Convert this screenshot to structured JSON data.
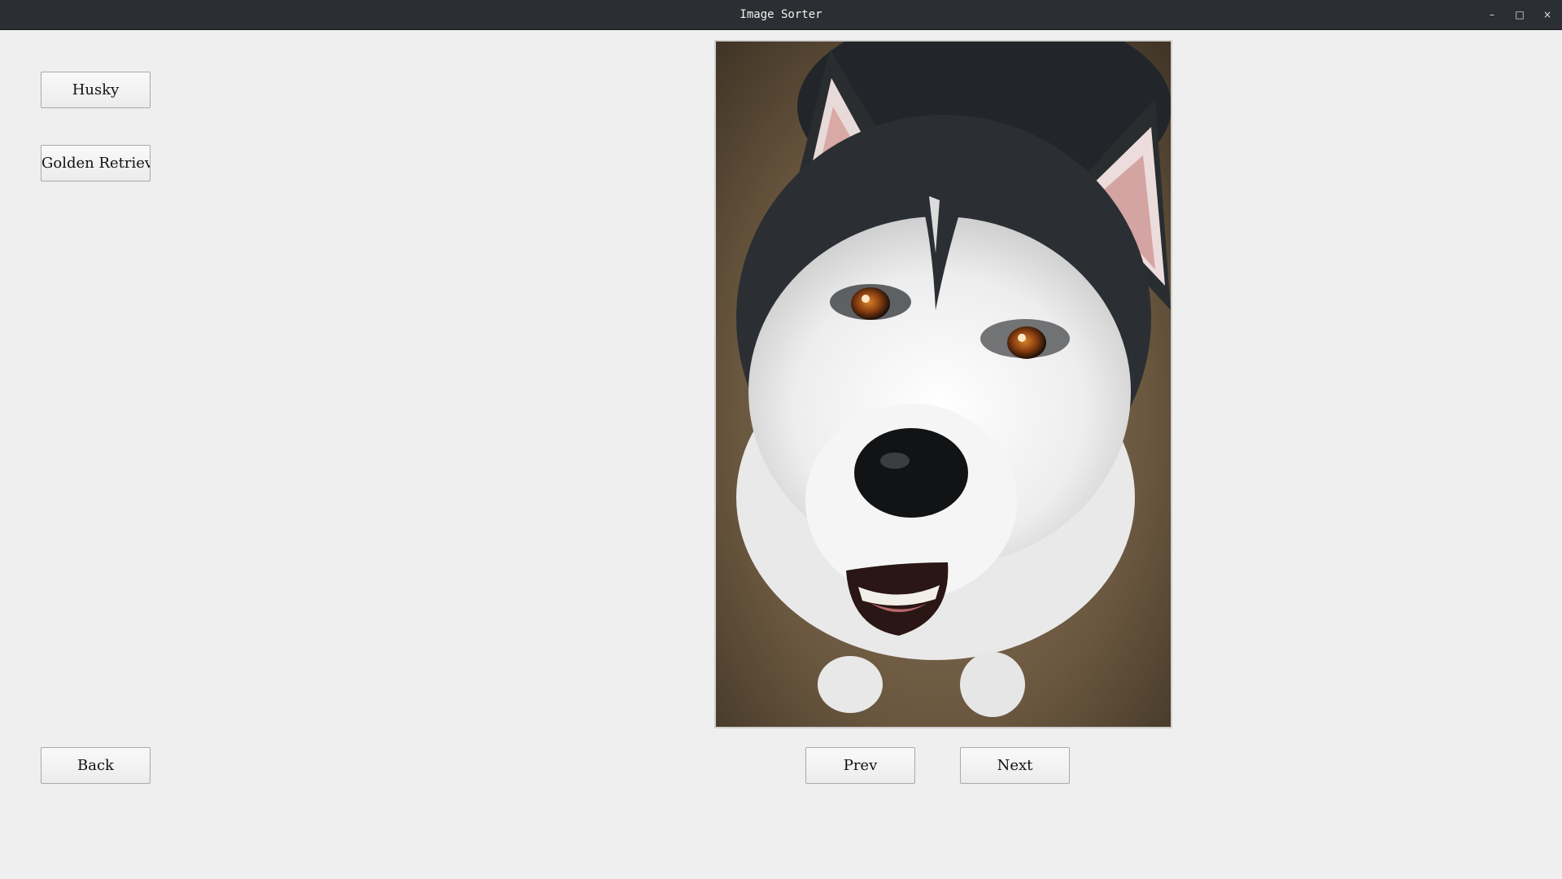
{
  "window": {
    "title": "Image Sorter",
    "controls": {
      "minimize": "–",
      "maximize": "□",
      "close": "×"
    }
  },
  "categories": [
    {
      "label": "Husky"
    },
    {
      "label": "Golden Retriever"
    }
  ],
  "navigation": {
    "back_label": "Back",
    "prev_label": "Prev",
    "next_label": "Next"
  },
  "image": {
    "subject": "husky-photo"
  },
  "colors": {
    "titlebar": "#2b2f33",
    "background": "#efefef",
    "button_border": "#a9a9a9"
  }
}
